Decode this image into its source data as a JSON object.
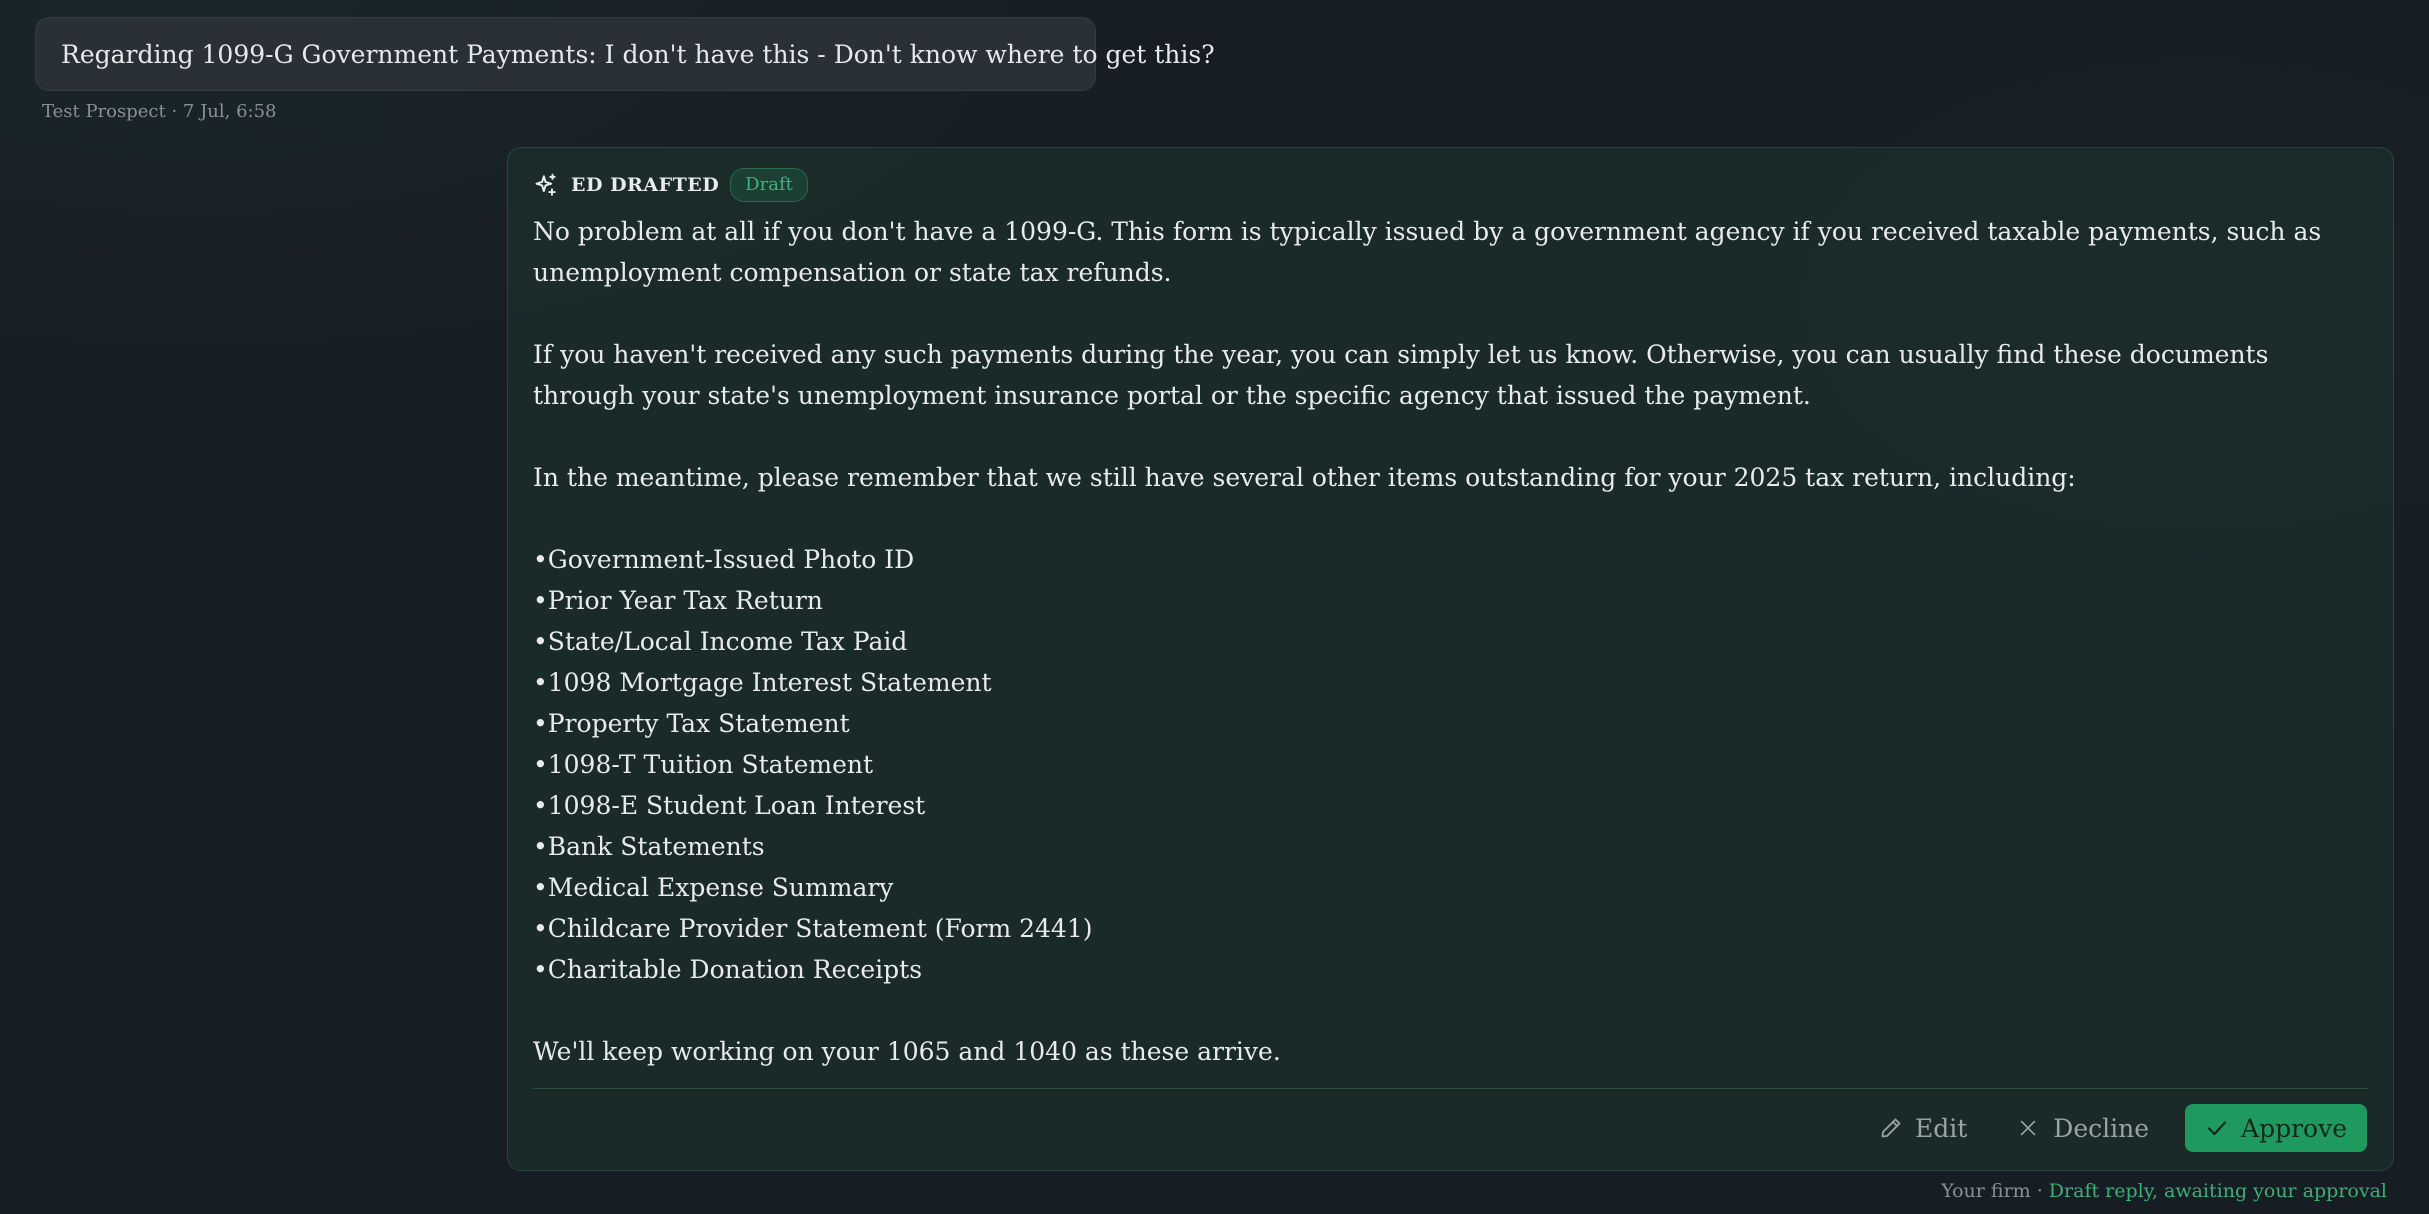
{
  "incoming_message": {
    "text": "Regarding 1099-G Government Payments: I don't have this - Don't know where to get this?",
    "meta": "Test Prospect · 7 Jul, 6:58"
  },
  "draft": {
    "author": "ED DRAFTED",
    "badge": "Draft",
    "icon": "sparkle-icon",
    "paragraphs": [
      "No problem at all if you don't have a 1099-G. This form is typically issued by a government agency if you received taxable payments, such as unemployment compensation or state tax refunds.",
      "If you haven't received any such payments during the year, you can simply let us know. Otherwise, you can usually find these documents through your state's unemployment insurance portal or the specific agency that issued the payment.",
      "In the meantime, please remember that we still have several other items outstanding for your 2025 tax return, including:"
    ],
    "items": [
      "Government-Issued Photo ID",
      "Prior Year Tax Return",
      "State/Local Income Tax Paid",
      "1098 Mortgage Interest Statement",
      "Property Tax Statement",
      "1098-T Tuition Statement",
      "1098-E Student Loan Interest",
      "Bank Statements",
      "Medical Expense Summary",
      "Childcare Provider Statement (Form 2441)",
      "Charitable Donation Receipts"
    ],
    "closing": "We'll keep working on your 1065 and 1040 as these arrive.",
    "actions": {
      "edit_label": "Edit",
      "decline_label": "Decline",
      "approve_label": "Approve"
    }
  },
  "footer": {
    "sender": "Your firm · ",
    "status": "Draft reply, awaiting your approval"
  },
  "colors": {
    "background": "#171d25",
    "accent_green": "#1f9a5f",
    "badge_green": "#3fb37a",
    "bubble": "#2a3038"
  }
}
